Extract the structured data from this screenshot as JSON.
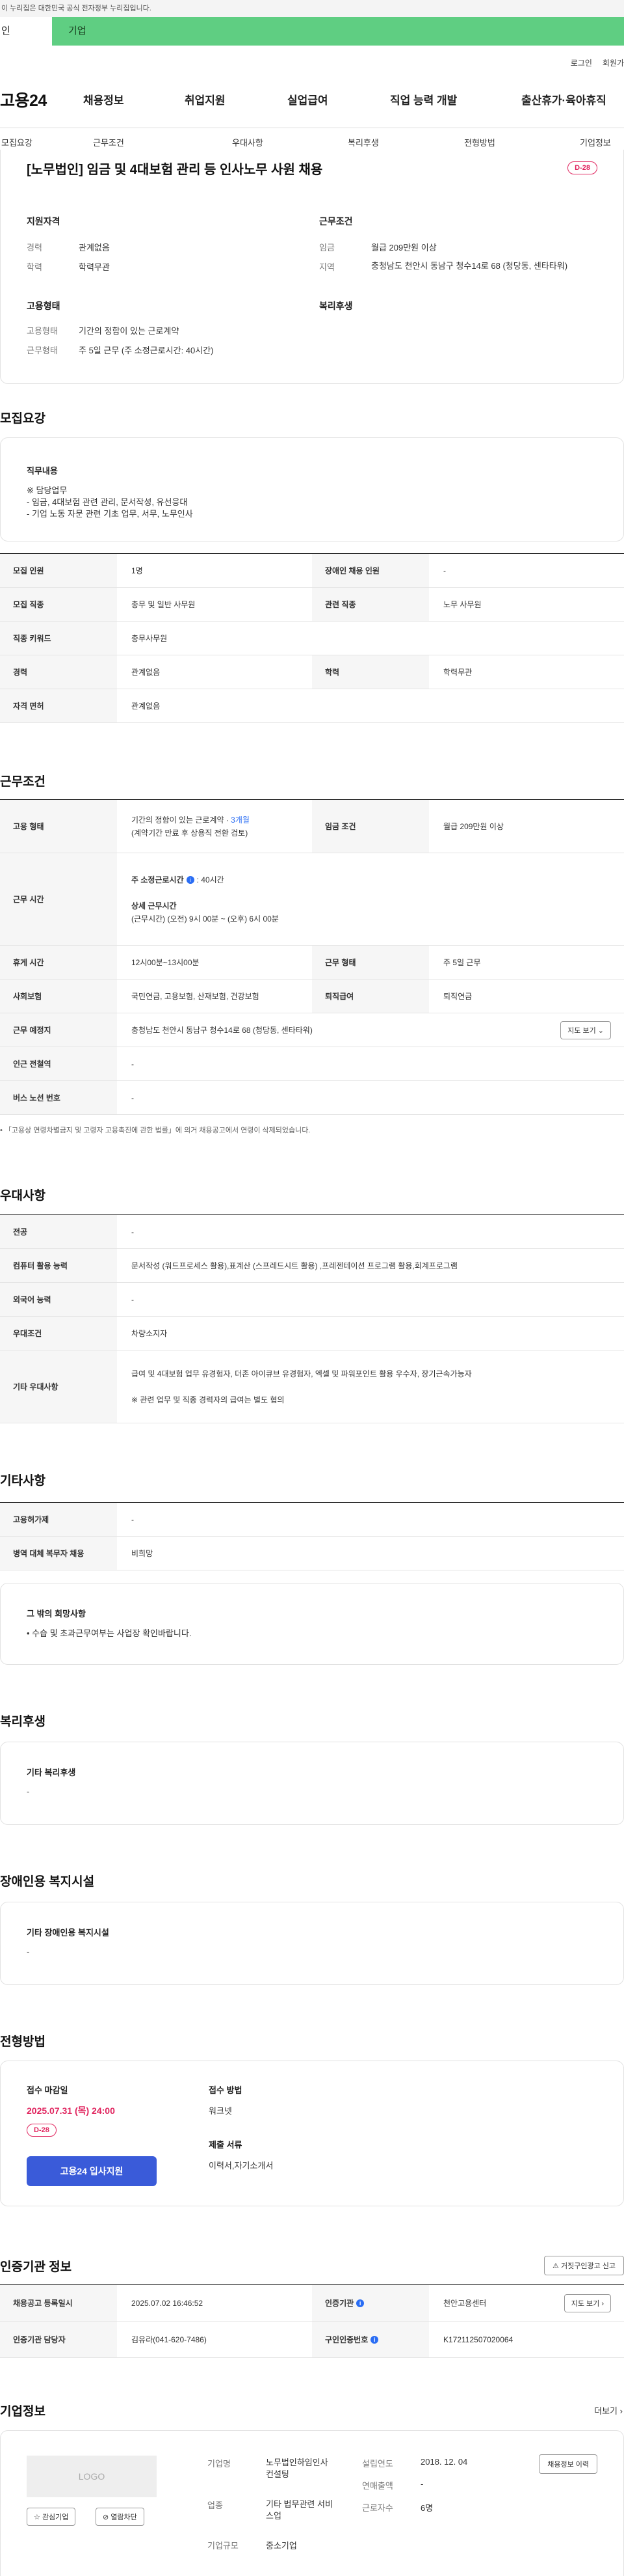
{
  "gov_notice": "이 누리집은 대한민국 공식 전자정부 누리집입니다.",
  "gov_tabs": {
    "personal": "인",
    "company": "기업"
  },
  "util_links": [
    "로그인",
    "회원가"
  ],
  "logo": "고용24",
  "top_menu": [
    "채용정보",
    "취업지원",
    "실업급여",
    "직업 능력 개발",
    "출산휴가·육아휴직"
  ],
  "tabs": [
    "모집요강",
    "근무조건",
    "우대사항",
    "복리후생",
    "전형방법",
    "기업정보"
  ],
  "job": {
    "title": "[노무법인] 임금 및 4대보험 관리 등 인사노무 사원 채용",
    "dday": "D-28",
    "qual_title": "지원자격",
    "cond_title": "근무조건",
    "emp_title": "고용형태",
    "welfare_title": "복리후생",
    "career_label": "경력",
    "career": "관계없음",
    "edu_label": "학력",
    "edu": "학력무관",
    "wage_label": "임금",
    "wage": "월급 209만원 이상",
    "region_label": "지역",
    "region": "충청남도 천안시 동남구 청수14로 68 (청당동, 센타타워)",
    "emptype_label": "고용형태",
    "emptype": "기간의 정함이 있는 근로계약",
    "worktype_label": "근무형태",
    "worktype": "주 5일 근무 (주 소정근로시간: 40시간)"
  },
  "recruit": {
    "title": "모집요강",
    "duty_label": "직무내용",
    "duty_lines": [
      "※ 담당업무",
      "- 임금, 4대보험 관련 관리, 문서작성, 유선응대",
      "- 기업 노동 자문 관련 기초 업무, 서무, 노무인사"
    ],
    "rows": {
      "count_label": "모집 인원",
      "count": "1명",
      "disabled_label": "장애인 채용 인원",
      "disabled": "-",
      "job_label": "모집 직종",
      "job": "총무 및 일반 사무원",
      "rel_label": "관련 직종",
      "rel": "노무 사무원",
      "kw_label": "직종 키워드",
      "kw": "총무사무원",
      "career_label": "경력",
      "career": "관계없음",
      "edu_label": "학력",
      "edu": "학력무관",
      "license_label": "자격 면허",
      "license": "관계없음"
    }
  },
  "work": {
    "title": "근무조건",
    "emptype_label": "고용 형태",
    "emptype_1": "기간의 정함이 있는 근로계약 · ",
    "emptype_months": "3개월",
    "emptype_2": "(계약기간 만료 후 상용직 전환 검토)",
    "wage_label": "임금 조건",
    "wage": "월급 209만원 이상",
    "hours_label": "근무 시간",
    "weekly_title": "주 소정근로시간",
    "weekly_val": ": 40시간",
    "detail_title": "상세 근무시간",
    "detail_val": "(근무시간) (오전) 9시 00분 ~ (오후) 6시 00분",
    "break_label": "휴게 시간",
    "break": "12시00분~13시00분",
    "form_label": "근무 형태",
    "form": "주 5일 근무",
    "ins_label": "사회보험",
    "ins": "국민연금, 고용보험, 산재보험, 건강보험",
    "ret_label": "퇴직급여",
    "ret": "퇴직연금",
    "place_label": "근무 예정지",
    "place": "충청남도 천안시 동남구 청수14로 68 (청당동, 센타타워)",
    "map_btn": "지도 보기",
    "subway_label": "인근 전철역",
    "subway": "-",
    "bus_label": "버스 노선 번호",
    "bus": "-",
    "notice": "「고용상 연령차별금지 및 고령자 고용촉진에 관한 법률」에 의거 채용공고에서 연령이 삭제되었습니다."
  },
  "pref": {
    "title": "우대사항",
    "major_label": "전공",
    "major": "-",
    "pc_label": "컴퓨터 활용 능력",
    "pc": "문서작성 (워드프로세스 활용),표계산 (스프레드시트 활용) ,프레젠테이션 프로그램 활용,회계프로그램",
    "lang_label": "외국어 능력",
    "lang": "-",
    "cond_label": "우대조건",
    "cond": "차량소지자",
    "etc_label": "기타 우대사항",
    "etc_1": "급여 및 4대보험 업무 유경험자, 더존 아이큐브 유경험자, 엑셀 및 파워포인트 활용 우수자, 장기근속가능자",
    "etc_2": "※ 관련 업무 및 직종 경력자의 급여는 별도 협의"
  },
  "etc": {
    "title": "기타사항",
    "insur_label": "고용허가제",
    "insur": "-",
    "mil_label": "병역 대체 복무자 채용",
    "mil": "비희망",
    "wish_label": "그 밖의 희망사항",
    "wish": "• 수습 및 초과근무여부는 사업장 확인바랍니다."
  },
  "welfare": {
    "title": "복리후생",
    "label": "기타 복리후생",
    "val": "-"
  },
  "disab": {
    "title": "장애인용 복지시설",
    "label": "기타 장애인용 복지시설",
    "val": "-"
  },
  "selection": {
    "title": "전형방법",
    "deadline_label": "접수 마감일",
    "deadline": "2025.07.31 (목) 24:00",
    "dday": "D-28",
    "apply_btn": "고용24 입사지원",
    "method_label": "접수 방법",
    "method": "워크넷",
    "docs_label": "제출 서류",
    "docs": "이력서,자기소개서"
  },
  "agency": {
    "title": "인증기관 정보",
    "report_btn": "거짓구인광고 신고",
    "reg_label": "채용공고 등록일시",
    "reg": "2025.07.02 16:46:52",
    "inst_label": "인증기관",
    "inst": "천안고용센터",
    "map_btn": "지도 보기",
    "mgr_label": "인증기관 담당자",
    "mgr": "김유라(041-620-7486)",
    "num_label": "구인인증번호",
    "num": "K172112507020064"
  },
  "company": {
    "title": "기업정보",
    "more": "더보기",
    "logo_text": "LOGO",
    "fav_btn": "관심기업",
    "block_btn": "열람차단",
    "name_label": "기업명",
    "name": "노무법인하임인사 컨설팅",
    "ind_label": "업종",
    "ind": "기타 법무관련 서비스업",
    "size_label": "기업규모",
    "size": "중소기업",
    "est_label": "설립연도",
    "est": "2018. 12. 04",
    "sales_label": "연매출액",
    "sales": "-",
    "emp_label": "근로자수",
    "emp": "6명",
    "jobs_btn": "채용정보 이력"
  }
}
